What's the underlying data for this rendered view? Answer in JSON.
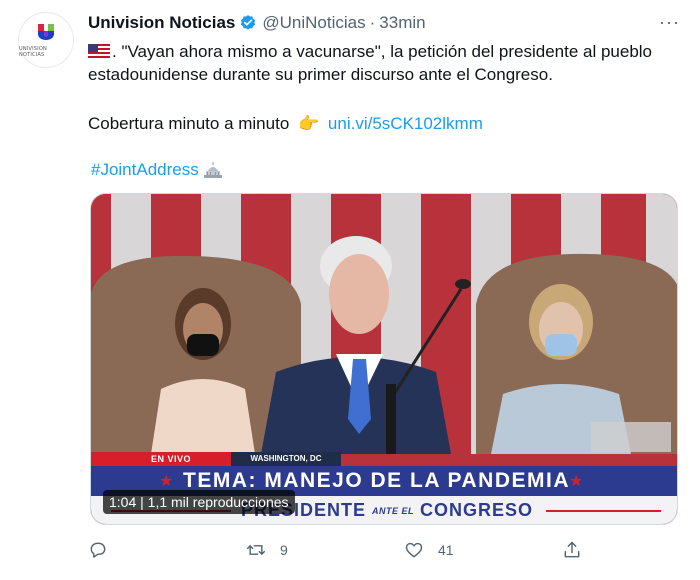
{
  "tweet": {
    "author": {
      "display_name": "Univision Noticias",
      "handle": "@UniNoticias",
      "separator": "·",
      "time": "33min",
      "avatar_text": "UNIVISION NOTICIAS"
    },
    "text_main": ". \"Vayan ahora mismo a vacunarse\", la petición del presidente al pueblo estadounidense durante su primer discurso ante el Congreso.",
    "text_coverage": "Cobertura minuto a minuto",
    "link": "uni.vi/5sCK102lkmm",
    "hashtag": "#JointAddress",
    "more_label": "···"
  },
  "media": {
    "live_label": "EN VIVO",
    "location": "WASHINGTON, DC",
    "headline": "TEMA: MANEJO DE LA PANDEMIA",
    "sub_left": "PRESIDENTE",
    "sub_mid": "ANTE EL",
    "sub_right": "CONGRESO",
    "duration": "1:04",
    "views": "1,1 mil reproducciones"
  },
  "actions": {
    "reply_count": "",
    "retweet_count": "9",
    "like_count": "41"
  },
  "icons": [
    "us-flag-icon",
    "verified-icon",
    "pointing-hand-icon",
    "capitol-icon",
    "reply-icon",
    "retweet-icon",
    "like-icon",
    "share-icon"
  ],
  "colors": {
    "link": "#1d9bf0",
    "muted": "#536471",
    "banner_blue": "#2c3b8f",
    "banner_red": "#d61f2b"
  }
}
